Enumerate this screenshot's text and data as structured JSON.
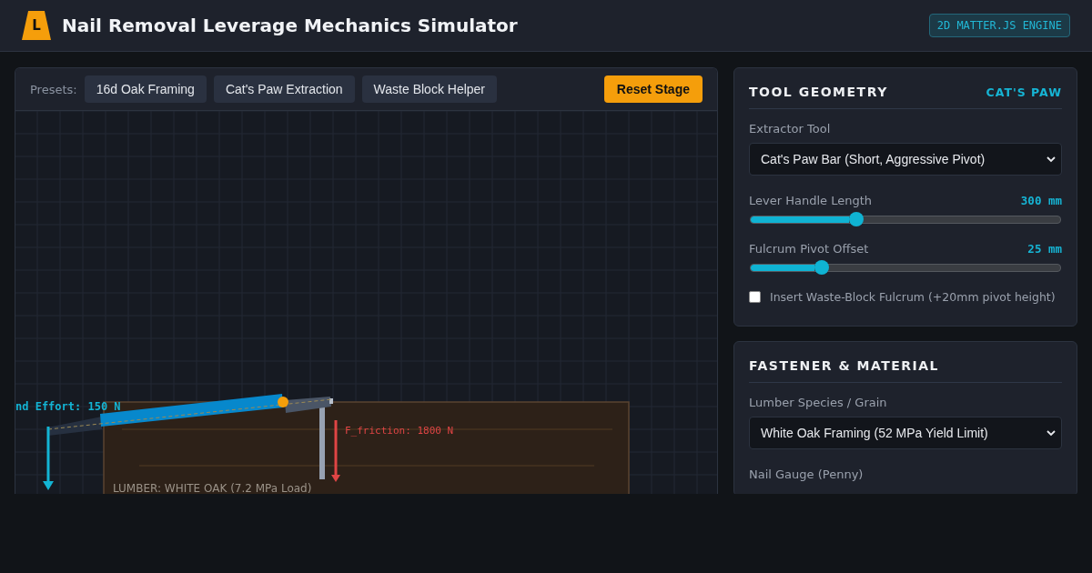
{
  "header": {
    "logo_letter": "L",
    "title": "Nail Removal Leverage Mechanics Simulator",
    "engine_badge": "2D MATTER.JS ENGINE"
  },
  "toolbar": {
    "presets_label": "Presets:",
    "presets": [
      "16d Oak Framing",
      "Cat's Paw Extraction",
      "Waste Block Helper"
    ],
    "reset_button": "Reset Stage"
  },
  "stage": {
    "effort_label": "nd Effort: 150 N",
    "friction_label": "F_friction: 1800 N",
    "lumber_label": "LUMBER: WHITE OAK (7.2 MPa Load)"
  },
  "panels": [
    {
      "title": "TOOL GEOMETRY",
      "tag": "CAT'S PAW",
      "controls": [
        {
          "kind": "select",
          "label": "Extractor Tool",
          "value": "Cat's Paw Bar (Short, Aggressive Pivot)"
        },
        {
          "kind": "slider",
          "label": "Lever Handle Length",
          "reading": "300 mm",
          "level": 0.34
        },
        {
          "kind": "slider",
          "label": "Fulcrum Pivot Offset",
          "reading": "25 mm",
          "level": 0.23
        },
        {
          "kind": "checkbox",
          "label": "Insert Waste-Block Fulcrum (+20mm pivot height)",
          "checked": false
        }
      ]
    },
    {
      "title": "FASTENER & MATERIAL",
      "controls": [
        {
          "kind": "select",
          "label": "Lumber Species / Grain",
          "value": "White Oak Framing (52 MPa Yield Limit)"
        },
        {
          "kind": "label",
          "label": "Nail Gauge (Penny)"
        }
      ]
    }
  ]
}
